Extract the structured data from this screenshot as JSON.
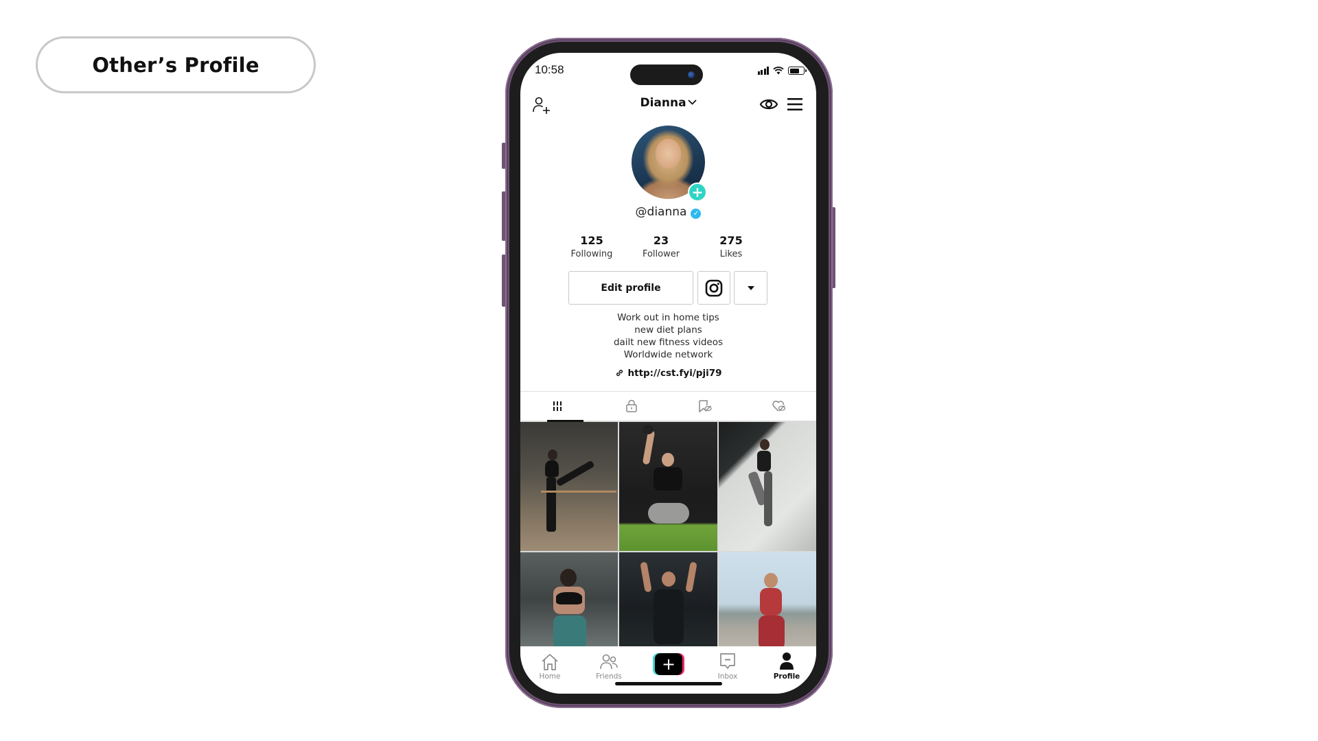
{
  "page_label": "Other’s Profile",
  "status_bar": {
    "time": "10:58",
    "icons": [
      "signal-icon",
      "wifi-icon",
      "battery-icon"
    ]
  },
  "top_nav": {
    "add_friend_icon": "person-add-icon",
    "username": "Dianna",
    "dropdown_icon": "chevron-down-icon",
    "eye_icon": "eye-icon",
    "menu_icon": "hamburger-menu-icon"
  },
  "profile": {
    "handle": "@dianna",
    "verified": true,
    "add_badge": "+",
    "accent_color": "#2fd5c4",
    "verified_color": "#2fb9ee"
  },
  "stats": [
    {
      "value": "125",
      "label": "Following"
    },
    {
      "value": "23",
      "label": "Follower"
    },
    {
      "value": "275",
      "label": "Likes"
    }
  ],
  "actions": {
    "edit_profile_label": "Edit profile",
    "instagram_icon": "instagram-icon",
    "more_icon": "caret-down-icon"
  },
  "bio": {
    "lines": [
      "Work out in home tips",
      "new diet plans",
      "dailt new fitness videos",
      "Worldwide network"
    ],
    "link": "http://cst.fyi/pji79"
  },
  "content_tabs": [
    {
      "name": "videos",
      "icon": "grid-icon",
      "active": true
    },
    {
      "name": "private",
      "icon": "lock-icon",
      "active": false
    },
    {
      "name": "saved",
      "icon": "bookmark-hidden-icon",
      "active": false
    },
    {
      "name": "liked",
      "icon": "heart-hidden-icon",
      "active": false
    }
  ],
  "videos": [
    {
      "description": "woman stretching at ballet barre"
    },
    {
      "description": "woman squatting with kettlebell"
    },
    {
      "description": "woman jumping in studio"
    },
    {
      "description": "woman from behind with weights overhead"
    },
    {
      "description": "woman doing pull-ups"
    },
    {
      "description": "woman with battle rope outdoors"
    }
  ],
  "bottom_nav": [
    {
      "label": "Home",
      "icon": "home-icon",
      "active": false
    },
    {
      "label": "Friends",
      "icon": "friends-icon",
      "active": false
    },
    {
      "label": "",
      "icon": "create-plus-icon",
      "active": false
    },
    {
      "label": "Inbox",
      "icon": "inbox-icon",
      "active": false
    },
    {
      "label": "Profile",
      "icon": "profile-icon",
      "active": true
    }
  ],
  "create_button_symbol": "+"
}
